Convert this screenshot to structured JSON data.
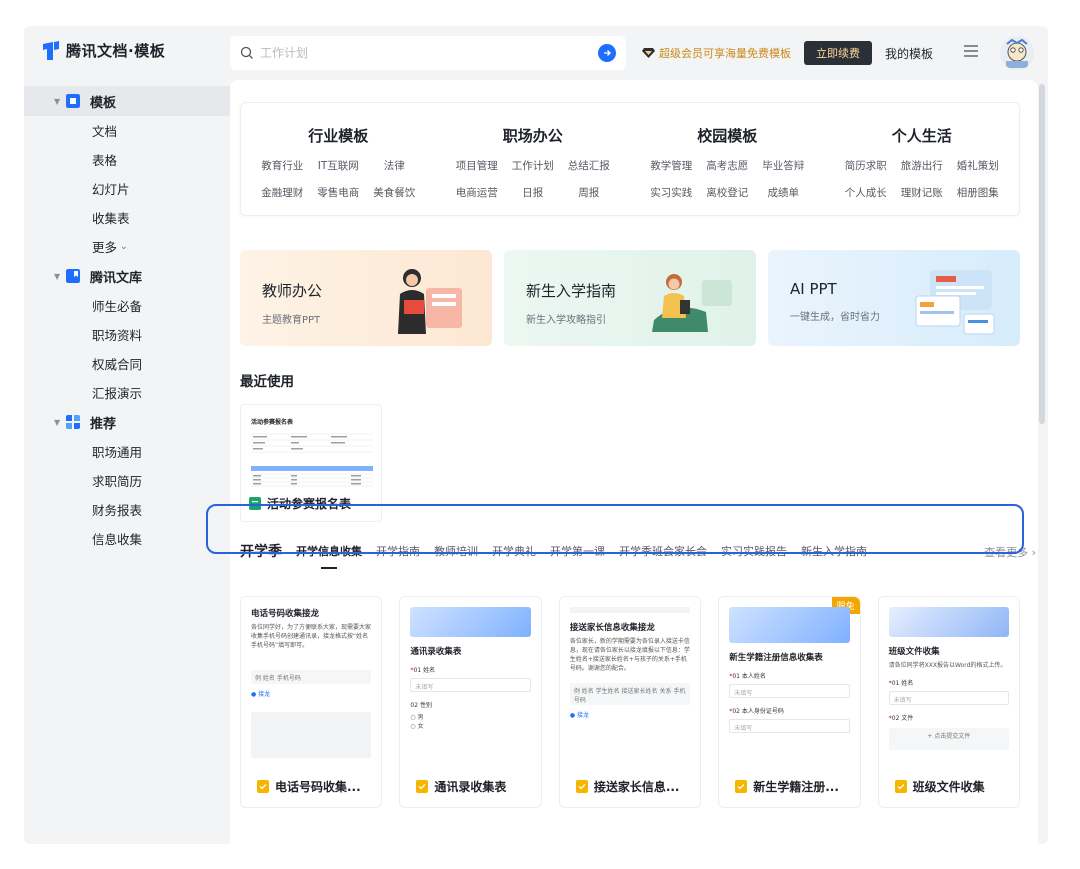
{
  "app": {
    "title": "腾讯文档·模板"
  },
  "search": {
    "placeholder": "工作计划"
  },
  "promo": {
    "text": "超级会员可享海量免费模板"
  },
  "header": {
    "renew_label": "立即续费",
    "my_templates_label": "我的模板"
  },
  "sidebar": {
    "groups": [
      {
        "label": "模板",
        "items": [
          "文档",
          "表格",
          "幻灯片",
          "收集表",
          "更多"
        ]
      },
      {
        "label": "腾讯文库",
        "items": [
          "师生必备",
          "职场资料",
          "权威合同",
          "汇报演示"
        ]
      },
      {
        "label": "推荐",
        "items": [
          "职场通用",
          "求职简历",
          "财务报表",
          "信息收集"
        ]
      }
    ]
  },
  "categories": [
    {
      "title": "行业模板",
      "links": [
        "教育行业",
        "IT互联网",
        "法律",
        "金融理财",
        "零售电商",
        "美食餐饮"
      ]
    },
    {
      "title": "职场办公",
      "links": [
        "项目管理",
        "工作计划",
        "总结汇报",
        "电商运营",
        "日报",
        "周报"
      ]
    },
    {
      "title": "校园模板",
      "links": [
        "教学管理",
        "高考志愿",
        "毕业答辩",
        "实习实践",
        "离校登记",
        "成绩单"
      ]
    },
    {
      "title": "个人生活",
      "links": [
        "简历求职",
        "旅游出行",
        "婚礼策划",
        "个人成长",
        "理财记账",
        "相册图集"
      ]
    }
  ],
  "banners": [
    {
      "title": "教师办公",
      "subtitle": "主题教育PPT"
    },
    {
      "title": "新生入学指南",
      "subtitle": "新生入学攻略指引"
    },
    {
      "title": "AI PPT",
      "subtitle": "一键生成，省时省力"
    }
  ],
  "recent": {
    "section_title": "最近使用",
    "item_name": "活动参赛报名表",
    "thumb_title": "活动参赛报名表"
  },
  "season": {
    "title": "开学季",
    "tabs": [
      "开学信息收集",
      "开学指南",
      "教师培训",
      "开学典礼",
      "开学第一课",
      "开学季班会家长会",
      "实习实践报告",
      "新生入学指南"
    ],
    "see_more": "查看更多"
  },
  "templates": [
    {
      "name": "电话号码收集...",
      "preview_title": "电话号码收集接龙",
      "preview_text": "各位同学好，为了方便联系大家，现需要大家收集手机号码创建通讯录，接龙格式按“姓名 手机号码”填写即可。",
      "field": "例  姓名  手机号码",
      "button": "接龙"
    },
    {
      "name": "通讯录收集表",
      "preview_title": "通讯录收集表",
      "q1": "01 姓名",
      "q1_input": "未填写",
      "q2": "02 性别",
      "opt1": "男",
      "opt2": "女"
    },
    {
      "name": "接送家长信息...",
      "preview_title": "接送家长信息收集接龙",
      "preview_text": "各位家长，新的学期需要为各位录入接送卡信息，现在请各位家长以接龙填报以下信息：学生姓名+接送家长姓名+与孩子的关系+手机号码。谢谢您的配合。",
      "field": "例  姓名  学生姓名 接送家长姓名 关系 手机号码",
      "button": "接龙"
    },
    {
      "name": "新生学籍注册...",
      "badge": "限免",
      "preview_title": "新生学籍注册信息收集表",
      "q1": "01 本人姓名",
      "q1_input": "未填写",
      "q2": "02 本人身份证号码",
      "q2_input": "未填写"
    },
    {
      "name": "班级文件收集",
      "preview_title": "班级文件收集",
      "preview_text": "请各位同学将XXX报告以Word的格式上传。",
      "q1": "01 姓名",
      "q1_input": "未填写",
      "q2": "02 文件",
      "upload": "+ 点击提交文件"
    }
  ],
  "colors": {
    "accent": "#1e6fff",
    "highlight_border": "#2a63d9",
    "badge": "#f4a500",
    "promo": "#c9891a"
  }
}
